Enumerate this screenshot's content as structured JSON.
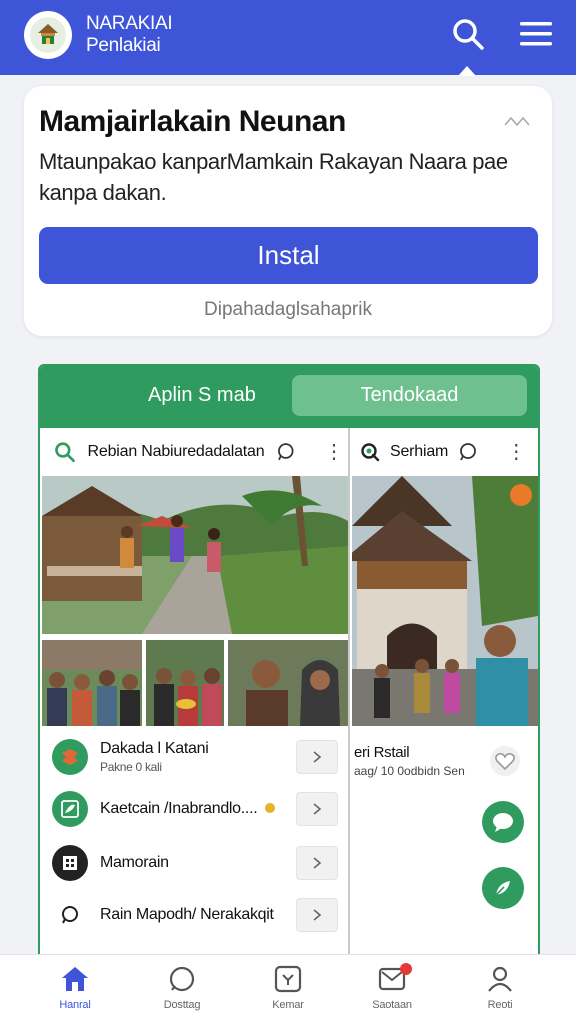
{
  "header": {
    "brand_line1": "NARAKIAI",
    "brand_line2": "Penlakiai",
    "logo_icon": "temple-logo-icon",
    "search_icon": "search-icon",
    "menu_icon": "hamburger-menu-icon"
  },
  "install_card": {
    "title": "Mamjairlakain Neunan",
    "description": "Mtaunpakao kanparMamkain Rakayan Naara    pae kanpa dakan.",
    "button_label": "Instal",
    "subtext": "Dipahadaglsahaprik",
    "close_icon": "close-icon"
  },
  "app_preview": {
    "tabs": {
      "left": "Aplin S mab",
      "right": "Tendokaad"
    },
    "left_panel": {
      "search_text": "Rebian Nabiuredadalatan",
      "list": [
        {
          "title": "Dakada l Katani",
          "subtitle": "Pakne 0 kali",
          "icon": "batik-pattern-icon"
        },
        {
          "title": "Kaetcain /Inabrandlo....",
          "subtitle": "",
          "icon": "leaf-pattern-icon"
        },
        {
          "title": "Mamorain",
          "subtitle": "",
          "icon": "building-icon"
        },
        {
          "title": "Rain Mapodh/ Nerakakqit",
          "subtitle": "",
          "icon": "chat-bubble-icon"
        }
      ]
    },
    "right_panel": {
      "search_text": "Serhiam",
      "card_title": "eri Rstail",
      "card_subtitle": "aag/ 10 0odbidn Sen"
    }
  },
  "bottom_nav": [
    {
      "label": "Hanral",
      "icon": "home-icon",
      "active": true
    },
    {
      "label": "Dosttag",
      "icon": "compass-icon",
      "active": false
    },
    {
      "label": "Kemar",
      "icon": "map-icon",
      "active": false
    },
    {
      "label": "Saotaan",
      "icon": "inbox-icon",
      "active": false
    },
    {
      "label": "Reoti",
      "icon": "profile-icon",
      "active": false
    }
  ],
  "colors": {
    "primary": "#3f55d8",
    "green": "#2f9b5f",
    "green_light": "#6fc08f"
  }
}
